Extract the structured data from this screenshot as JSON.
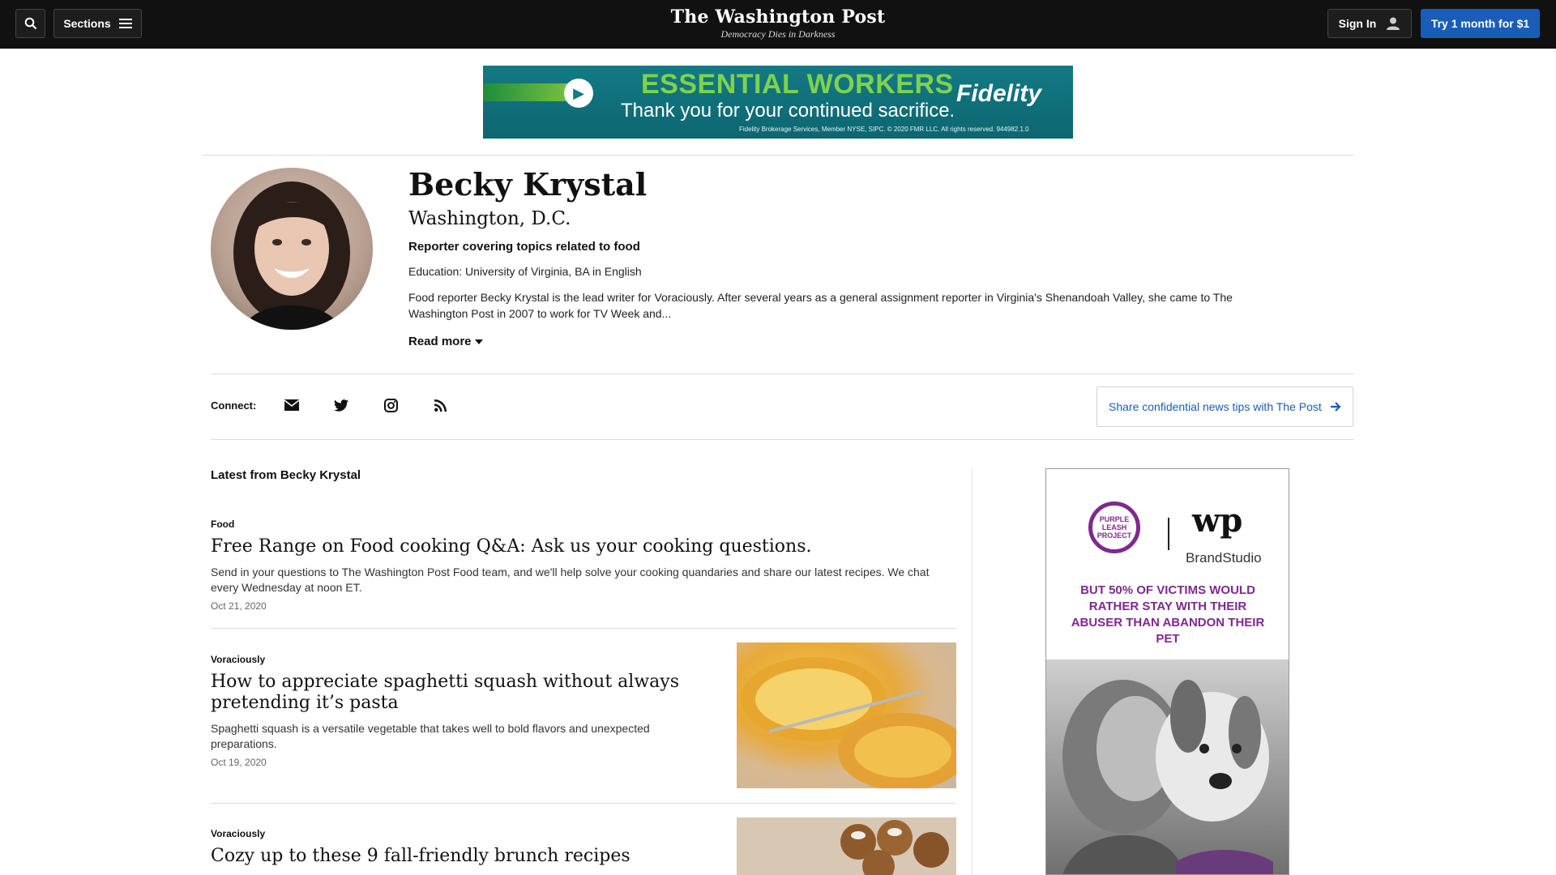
{
  "header": {
    "sections_label": "Sections",
    "logo": "The Washington Post",
    "tagline": "Democracy Dies in Darkness",
    "signin_label": "Sign In",
    "subscribe_label": "Try 1 month for $1"
  },
  "ad_banner": {
    "headline": "ESSENTIAL WORKERS",
    "subline": "Thank you for your continued sacrifice.",
    "brand": "Fidelity",
    "fineprint": "Fidelity Brokerage Services, Member NYSE, SIPC. © 2020 FMR LLC. All rights reserved. 944982.1.0"
  },
  "profile": {
    "name": "Becky Krystal",
    "location": "Washington, D.C.",
    "role": "Reporter covering topics related to food",
    "education": "Education: University of Virginia, BA in English",
    "bio": "Food reporter Becky Krystal is the lead writer for Voraciously. After several years as a general assignment reporter in Virginia's Shenandoah Valley, she came to The Washington Post in 2007 to work for TV Week and...",
    "read_more": "Read more"
  },
  "connect": {
    "label": "Connect:",
    "icons": [
      "email-icon",
      "twitter-icon",
      "instagram-icon",
      "rss-icon"
    ],
    "tips_label": "Share confidential news tips with The Post"
  },
  "latest": {
    "title": "Latest from Becky Krystal",
    "stories": [
      {
        "kicker": "Food",
        "headline": "Free Range on Food cooking Q&A: Ask us your cooking questions.",
        "blurb": "Send in your questions to The Washington Post Food team, and we'll help solve your cooking quandaries and share our latest recipes. We chat every Wednesday at noon ET.",
        "date": "Oct 21, 2020"
      },
      {
        "kicker": "Voraciously",
        "headline": "How to appreciate spaghetti squash without always pretending it’s pasta",
        "blurb": "Spaghetti squash is a versatile vegetable that takes well to bold flavors and unexpected preparations.",
        "date": "Oct 19, 2020"
      },
      {
        "kicker": "Voraciously",
        "headline": "Cozy up to these 9 fall-friendly brunch recipes"
      }
    ]
  },
  "side_ad": {
    "logo_text": "PURPLE LEASH PROJECT",
    "wp_mark": "wp",
    "brandstudio": "BrandStudio",
    "message": "BUT 50% OF VICTIMS WOULD RATHER STAY WITH THEIR ABUSER THAN ABANDON THEIR PET"
  },
  "colors": {
    "topbar": "#111111",
    "accent_blue": "#1a5db8",
    "ad_teal": "#137a84",
    "ad_green": "#7fd24c",
    "purple": "#7e2a8c"
  }
}
